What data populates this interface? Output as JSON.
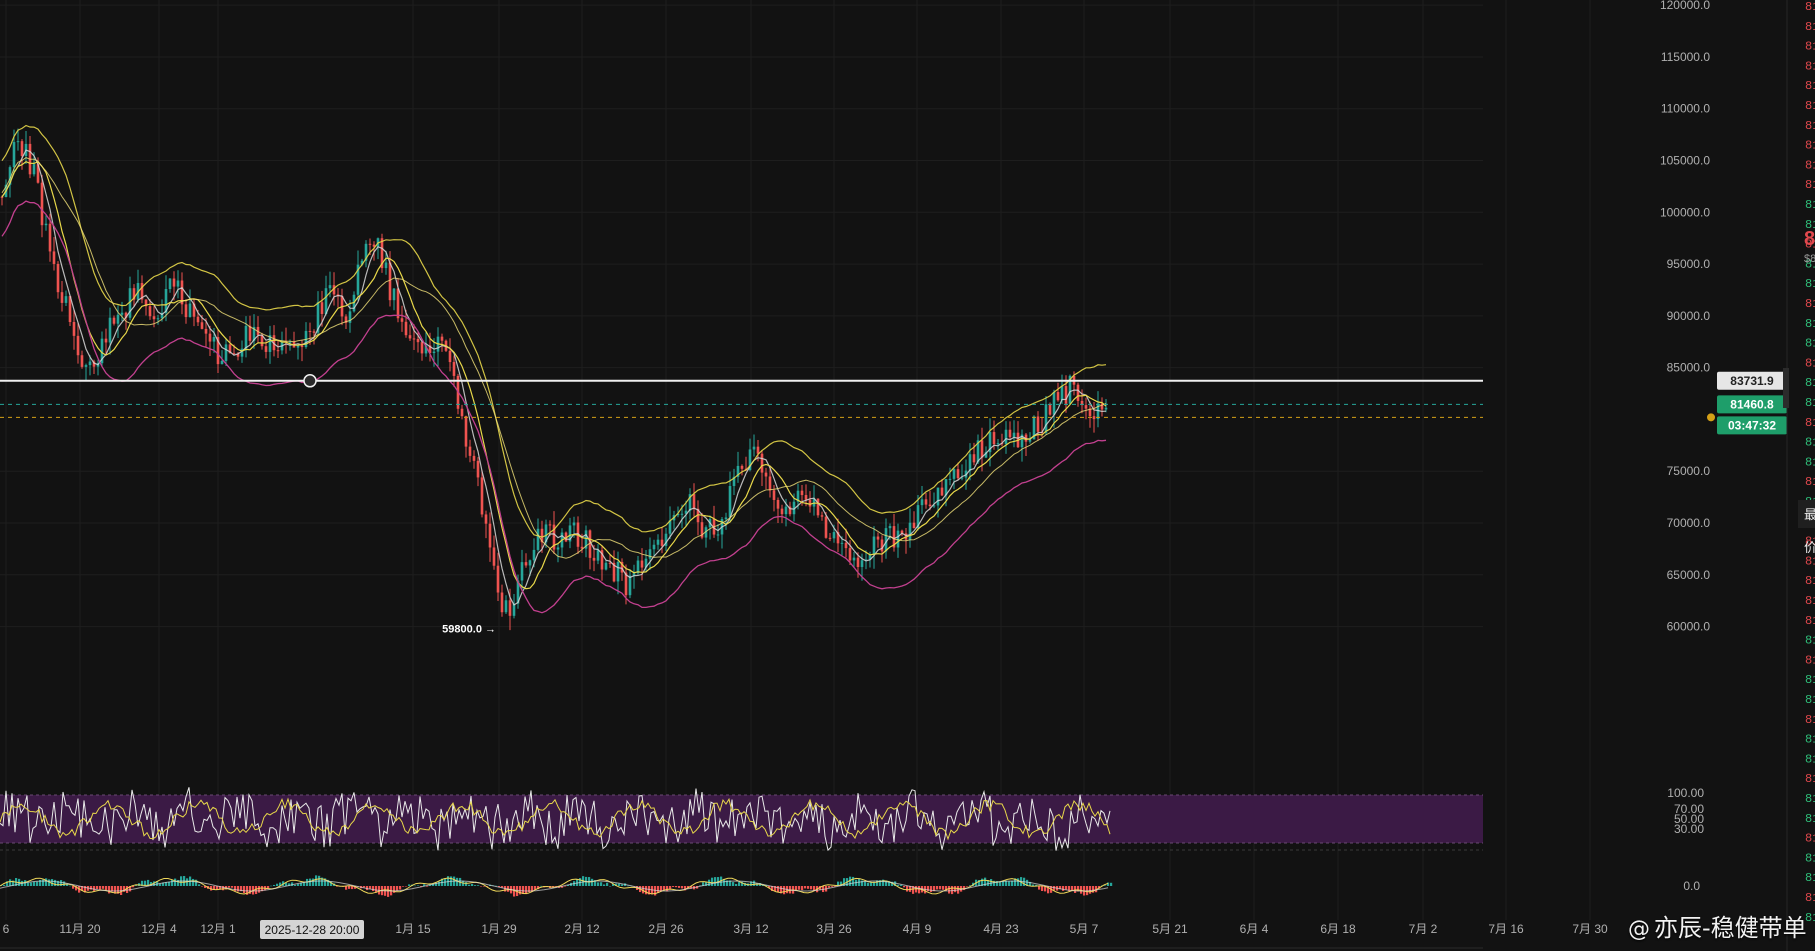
{
  "chart_data": {
    "type": "candlestick",
    "x_ticks": [
      "6",
      "11月 20",
      "12月 4",
      "12月 1",
      "1月 15",
      "1月 29",
      "2月 12",
      "2月 26",
      "3月 12",
      "3月 26",
      "4月 9",
      "4月 23",
      "5月 7",
      "5月 21",
      "6月 4",
      "6月 18",
      "7月 2",
      "7月 16",
      "7月 30"
    ],
    "y_ticks": [
      "120000.0",
      "115000.0",
      "110000.0",
      "105000.0",
      "100000.0",
      "95000.0",
      "90000.0",
      "85000.0",
      "75000.0",
      "70000.0",
      "65000.0",
      "60000.0"
    ],
    "ylim": [
      56000,
      120500
    ],
    "price_path": [
      [
        0,
        101500
      ],
      [
        8,
        104000
      ],
      [
        20,
        107000
      ],
      [
        36,
        103000
      ],
      [
        52,
        95000
      ],
      [
        70,
        90000
      ],
      [
        86,
        84000
      ],
      [
        96,
        86000
      ],
      [
        110,
        89000
      ],
      [
        126,
        91000
      ],
      [
        140,
        92500
      ],
      [
        156,
        89000
      ],
      [
        172,
        93000
      ],
      [
        190,
        90500
      ],
      [
        208,
        87000
      ],
      [
        228,
        86000
      ],
      [
        248,
        88000
      ],
      [
        268,
        87500
      ],
      [
        290,
        86500
      ],
      [
        310,
        88500
      ],
      [
        330,
        92500
      ],
      [
        346,
        90000
      ],
      [
        362,
        95500
      ],
      [
        376,
        97500
      ],
      [
        392,
        92000
      ],
      [
        410,
        88500
      ],
      [
        428,
        86500
      ],
      [
        442,
        88000
      ],
      [
        458,
        82000
      ],
      [
        472,
        76000
      ],
      [
        486,
        70000
      ],
      [
        500,
        62500
      ],
      [
        510,
        60500
      ],
      [
        524,
        66000
      ],
      [
        540,
        69500
      ],
      [
        556,
        68000
      ],
      [
        574,
        69000
      ],
      [
        592,
        67500
      ],
      [
        610,
        66000
      ],
      [
        626,
        64000
      ],
      [
        640,
        65500
      ],
      [
        656,
        67500
      ],
      [
        672,
        70500
      ],
      [
        690,
        72500
      ],
      [
        706,
        69000
      ],
      [
        720,
        70000
      ],
      [
        738,
        74500
      ],
      [
        754,
        77000
      ],
      [
        770,
        72500
      ],
      [
        786,
        71500
      ],
      [
        804,
        73000
      ],
      [
        822,
        70000
      ],
      [
        838,
        67500
      ],
      [
        856,
        66500
      ],
      [
        872,
        67500
      ],
      [
        888,
        68500
      ],
      [
        906,
        69500
      ],
      [
        924,
        71500
      ],
      [
        940,
        73000
      ],
      [
        958,
        75000
      ],
      [
        974,
        76500
      ],
      [
        990,
        77500
      ],
      [
        1006,
        79000
      ],
      [
        1022,
        78000
      ],
      [
        1038,
        79500
      ],
      [
        1054,
        81500
      ],
      [
        1070,
        83000
      ],
      [
        1084,
        82000
      ],
      [
        1098,
        80500
      ],
      [
        1110,
        81500
      ]
    ],
    "low_label": "59800.0",
    "horizontal_line": "83731.9",
    "last_price": "81460.8",
    "countdown": "03:47:32",
    "crosshair_time": "2025-12-28 20:00",
    "rsi_ticks": [
      "100.00",
      "70.00",
      "50.00",
      "30.00"
    ],
    "macd_ticks": [
      "0.0"
    ],
    "order_book_prices": [
      "81",
      "81",
      "81",
      "81",
      "81",
      "81",
      "81",
      "81",
      "81",
      "81",
      "81",
      "81",
      "81",
      "81",
      "81",
      "81",
      "81",
      "81",
      "81",
      "81",
      "81",
      "81",
      "81",
      "81",
      "81",
      "81",
      "81",
      "81",
      "81",
      "81",
      "81",
      "81",
      "81",
      "81",
      "81",
      "81",
      "81",
      "81",
      "81",
      "81",
      "81",
      "81",
      "81",
      "81",
      "81",
      "81",
      "81"
    ],
    "colors": {
      "background": "#121212",
      "up": "#26a69a",
      "down": "#ef5350",
      "ma_yellow": "#e8d84a",
      "ma_magenta": "#c2408f",
      "ma_white": "#e0e0e0",
      "rsi_band": "#3b1a45",
      "last_price_tag": "#1e9e6a"
    }
  },
  "side": {
    "big_price": "8",
    "small_price": "$8",
    "tab_1": "最",
    "tab_2": "价"
  },
  "watermark": {
    "at": "@",
    "text": "亦辰-稳健带单"
  }
}
